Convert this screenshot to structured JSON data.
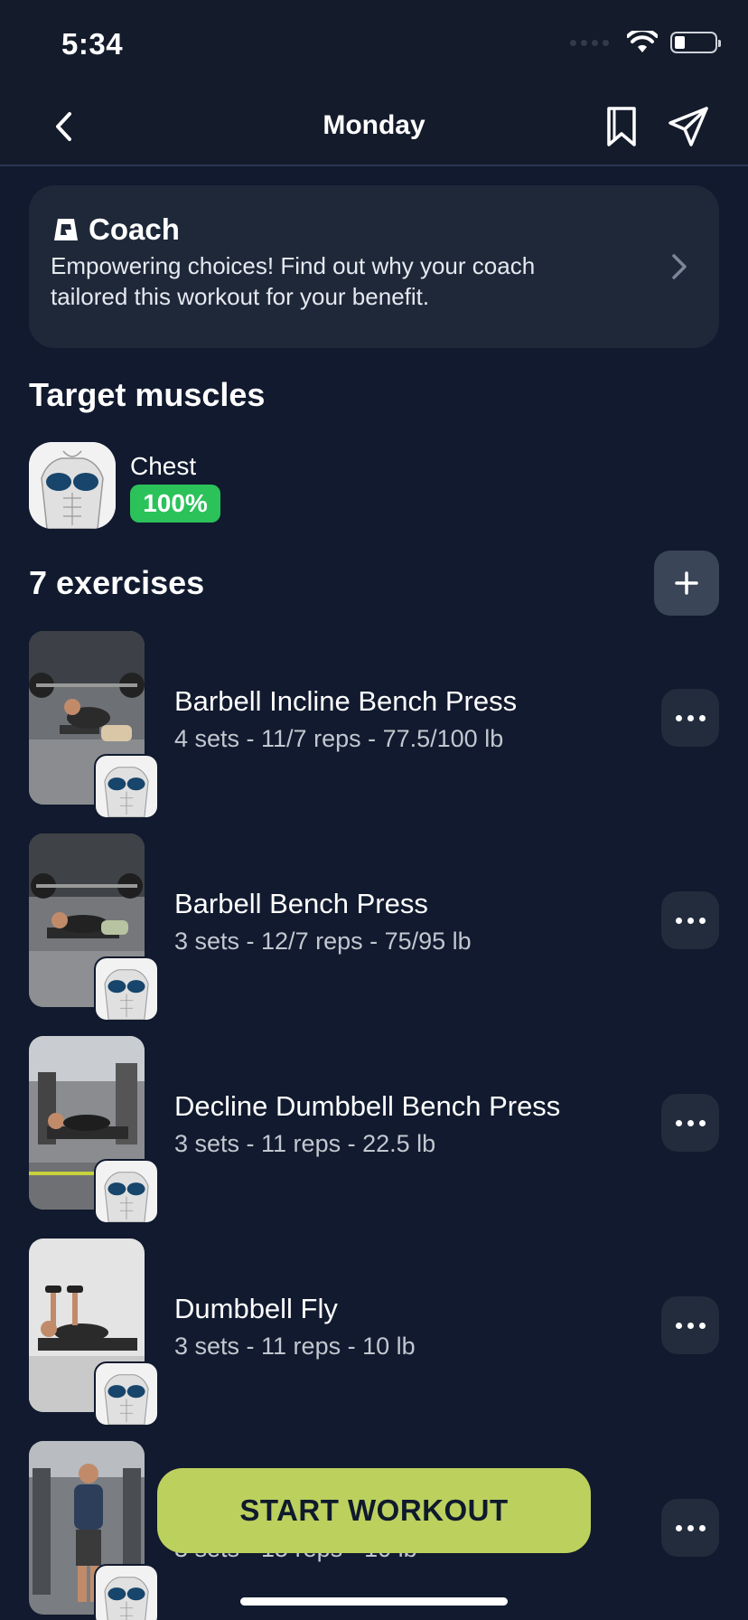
{
  "status_bar": {
    "time": "5:34"
  },
  "nav": {
    "title": "Monday"
  },
  "coach": {
    "title": "Coach",
    "text": "Empowering choices! Find out why your coach tailored this workout for your benefit."
  },
  "target_muscles": {
    "heading": "Target muscles",
    "items": [
      {
        "name": "Chest",
        "percent": "100%"
      }
    ]
  },
  "exercises_heading": "7 exercises",
  "exercises": [
    {
      "name": "Barbell Incline Bench Press",
      "detail": "4 sets - 11/7 reps - 77.5/100 lb"
    },
    {
      "name": "Barbell Bench Press",
      "detail": "3 sets - 12/7 reps - 75/95 lb"
    },
    {
      "name": "Decline Dumbbell Bench Press",
      "detail": "3 sets - 11 reps - 22.5 lb"
    },
    {
      "name": "Dumbbell Fly",
      "detail": "3 sets - 11 reps - 10 lb"
    },
    {
      "name": "",
      "detail": "3 sets - 15 reps - 10 lb"
    }
  ],
  "start_button": "START WORKOUT",
  "colors": {
    "background": "#111a2e",
    "card": "#1e2839",
    "accent_green": "#2bc25a",
    "start_button": "#bcd05e"
  }
}
